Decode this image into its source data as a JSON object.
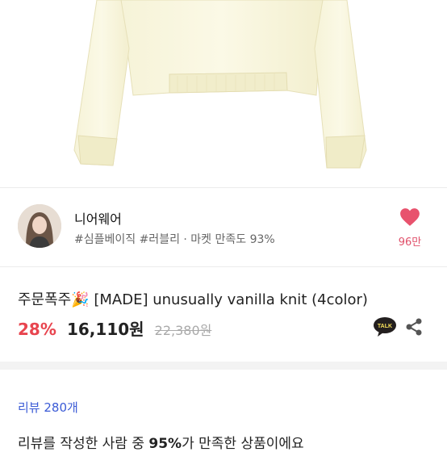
{
  "seller": {
    "name": "니어웨어",
    "tags": "#심플베이직 #러블리 · 마켓 만족도 93%",
    "likes": "96만"
  },
  "product": {
    "title": "주문폭주🎉 [MADE] unusually vanilla knit (4color)",
    "discount": "28%",
    "price": "16,110원",
    "original_price": "22,380원"
  },
  "talk_label": "TALK",
  "reviews": {
    "link": "리뷰 280개",
    "summary_pre": "리뷰를 작성한 사람 중 ",
    "summary_pct": "95%",
    "summary_post": "가 만족한 상품이에요"
  }
}
